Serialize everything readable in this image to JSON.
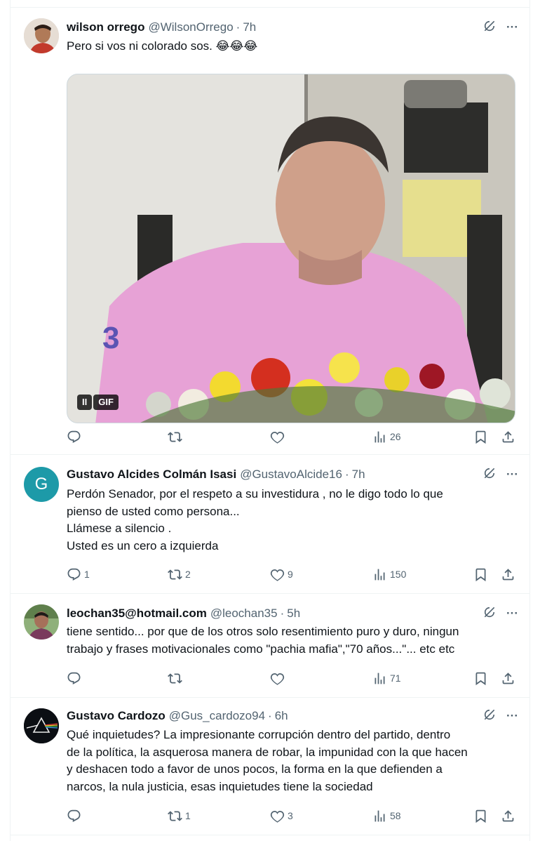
{
  "tweets": [
    {
      "name": "wilson orrego",
      "handle": "@WilsonOrrego",
      "time": "7h",
      "lines": [
        "Pero si vos ni colorado sos. 😂😂😂"
      ],
      "media": {
        "pause_label": "II",
        "gif_label": "GIF"
      },
      "replies": "",
      "retweets": "",
      "likes": "",
      "views": "26"
    },
    {
      "name": "Gustavo Alcides Colmán Isasi",
      "handle": "@GustavoAlcide16",
      "time": "7h",
      "avatar_letter": "G",
      "lines": [
        "Perdón Senador, por el respeto a su investidura , no le digo todo lo que",
        "pienso de usted como persona...",
        "Llámese a silencio .",
        "Usted es un cero a izquierda"
      ],
      "replies": "1",
      "retweets": "2",
      "likes": "9",
      "views": "150"
    },
    {
      "name": "leochan35@hotmail.com",
      "handle": "@leochan35",
      "time": "5h",
      "lines": [
        "tiene sentido... por que de los otros solo resentimiento puro y duro, ningun",
        "trabajo y frases motivacionales como \"pachia mafia\",\"70 años...\"... etc etc"
      ],
      "replies": "",
      "retweets": "",
      "likes": "",
      "views": "71"
    },
    {
      "name": "Gustavo Cardozo",
      "handle": "@Gus_cardozo94",
      "time": "6h",
      "lines": [
        "Qué inquietudes? La impresionante corrupción dentro del partido, dentro",
        "de la política, la asquerosa manera de robar, la impunidad con la que hacen",
        "y deshacen todo a favor de unos pocos, la forma en la que defienden a",
        "narcos, la nula justicia, esas inquietudes tiene la sociedad"
      ],
      "replies": "",
      "retweets": "1",
      "likes": "3",
      "views": "58"
    }
  ],
  "separator": "·",
  "more_glyph": "···",
  "colors": {
    "text": "#0f1419",
    "secondary": "#536471",
    "border": "#eff3f4",
    "avatar_teal": "#1d9aa8"
  },
  "icons": [
    "grok-icon",
    "more-icon",
    "reply-icon",
    "retweet-icon",
    "like-icon",
    "views-icon",
    "bookmark-icon",
    "share-icon"
  ]
}
